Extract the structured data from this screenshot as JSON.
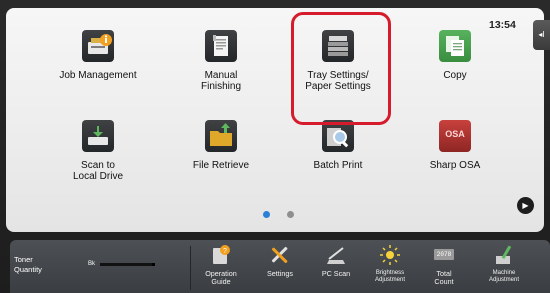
{
  "status": {
    "time": "13:54"
  },
  "side_tab": {
    "glyph": "◂I"
  },
  "apps": [
    {
      "label": "Job Management",
      "icon": "job-management-icon"
    },
    {
      "label": "Manual Finishing",
      "icon": "manual-finishing-icon"
    },
    {
      "label": "Tray Settings/ Paper Settings",
      "icon": "tray-settings-icon"
    },
    {
      "label": "Copy",
      "icon": "copy-icon"
    },
    {
      "label": "Scan to Local Drive",
      "icon": "scan-to-local-drive-icon"
    },
    {
      "label": "File Retrieve",
      "icon": "file-retrieve-icon"
    },
    {
      "label": "Batch Print",
      "icon": "batch-print-icon"
    },
    {
      "label": "Sharp OSA",
      "icon": "sharp-osa-icon",
      "icon_text": "OSA"
    }
  ],
  "pagination": {
    "pages": 2,
    "active": 1,
    "active_color": "#2b7fd6",
    "inactive_color": "#8f8f8f"
  },
  "highlight_color": "#d61c2c",
  "dock": {
    "toner": {
      "label": "Toner Quantity",
      "color_label": "Bk",
      "level": 0.95
    },
    "items": [
      {
        "label": "Operation Guide",
        "icon": "operation-guide-icon"
      },
      {
        "label": "Settings",
        "icon": "settings-icon"
      },
      {
        "label": "PC Scan",
        "icon": "pc-scan-icon"
      },
      {
        "label": "Brightness Adjustment",
        "icon": "brightness-icon"
      },
      {
        "label": "Total Count",
        "icon": "total-count-icon",
        "icon_text": "2078"
      },
      {
        "label": "Machine Adjustment",
        "icon": "machine-adjustment-icon"
      }
    ]
  }
}
